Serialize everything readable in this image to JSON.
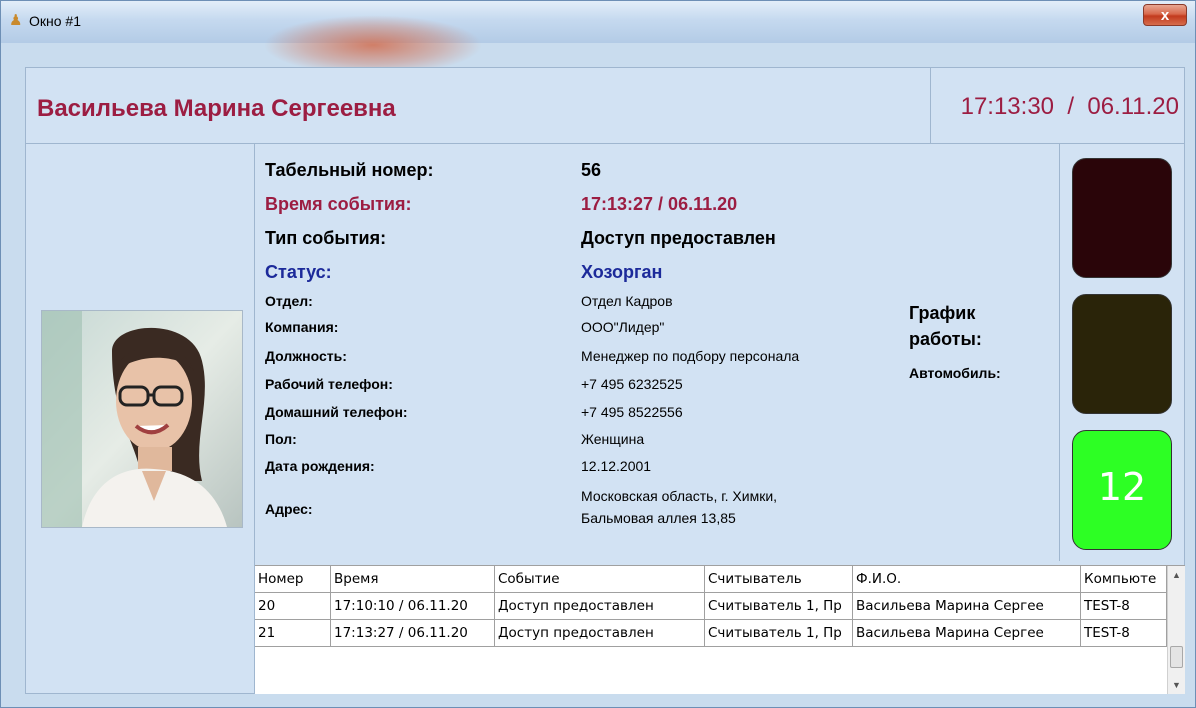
{
  "window": {
    "title": "Окно #1",
    "close_glyph": "x",
    "icon": "person-icon"
  },
  "header": {
    "name": "Васильева Марина Сергеевна",
    "clock": "17:13:30  /  06.11.20"
  },
  "fields": {
    "tab_label": "Табельный номер:",
    "tab_value": "56",
    "event_time_label": "Время события:",
    "event_time_value": "17:13:27 / 06.11.20",
    "event_type_label": "Тип события:",
    "event_type_value": "Доступ предоставлен",
    "status_label": "Статус:",
    "status_value": "Хозорган",
    "dept_label": "Отдел:",
    "dept_value": "Отдел Кадров",
    "company_label": "Компания:",
    "company_value": "ООО\"Лидер\"",
    "position_label": "Должность:",
    "position_value": "Менеджер по подбору персонала",
    "work_phone_label": "Рабочий телефон:",
    "work_phone_value": "+7 495 6232525",
    "home_phone_label": "Домашний телефон:",
    "home_phone_value": "+7 495 8522556",
    "gender_label": "Пол:",
    "gender_value": "Женщина",
    "birth_label": "Дата рождения:",
    "birth_value": "12.12.2001",
    "address_label": "Адрес:",
    "address_line1": "Московская область, г. Химки,",
    "address_line2": "Бальмовая аллея 13,85"
  },
  "schedule": {
    "line1": "График",
    "line2": "работы:",
    "car_label": "Автомобиль:"
  },
  "indicators": {
    "number": "12",
    "colors": [
      "#2a0509",
      "#2a2409",
      "#2dff24"
    ]
  },
  "events_table": {
    "headers": [
      "Номер",
      "Время",
      "Событие",
      "Считыватель",
      "Ф.И.О.",
      "Компьюте"
    ],
    "rows": [
      [
        "20",
        "17:10:10 / 06.11.20",
        "Доступ предоставлен",
        "Считыватель 1, Пр",
        "Васильева Марина Сергее",
        "TEST-8"
      ],
      [
        "21",
        "17:13:27 / 06.11.20",
        "Доступ предоставлен",
        "Считыватель 1, Пр",
        "Васильева Марина Сергее",
        "TEST-8"
      ]
    ]
  }
}
